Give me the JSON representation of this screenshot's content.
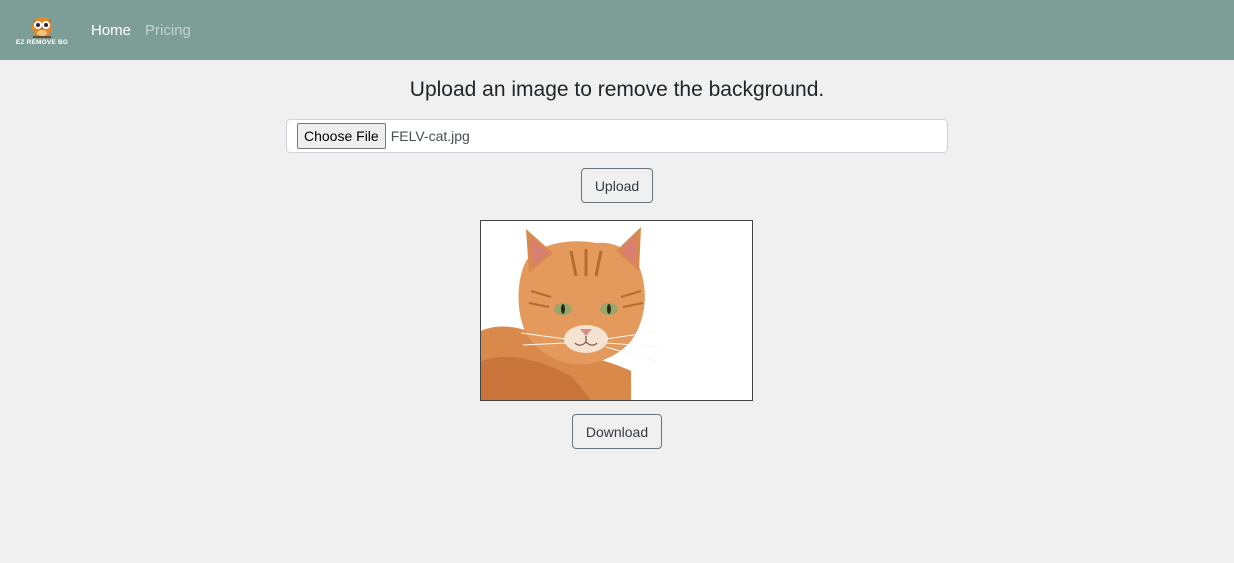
{
  "brand": {
    "logo_text": "EZ REMOVE BG",
    "icon": "owl-logo-icon"
  },
  "nav": {
    "items": [
      {
        "label": "Home",
        "active": true
      },
      {
        "label": "Pricing",
        "active": false
      }
    ]
  },
  "page": {
    "title": "Upload an image to remove the background."
  },
  "file_input": {
    "button_label": "Choose File",
    "file_name": "FELV-cat.jpg"
  },
  "upload_button": {
    "label": "Upload"
  },
  "preview": {
    "alt": "cat"
  },
  "download_button": {
    "label": "Download"
  },
  "colors": {
    "navbar": "#7d9e97",
    "background": "#f0f0f0"
  }
}
